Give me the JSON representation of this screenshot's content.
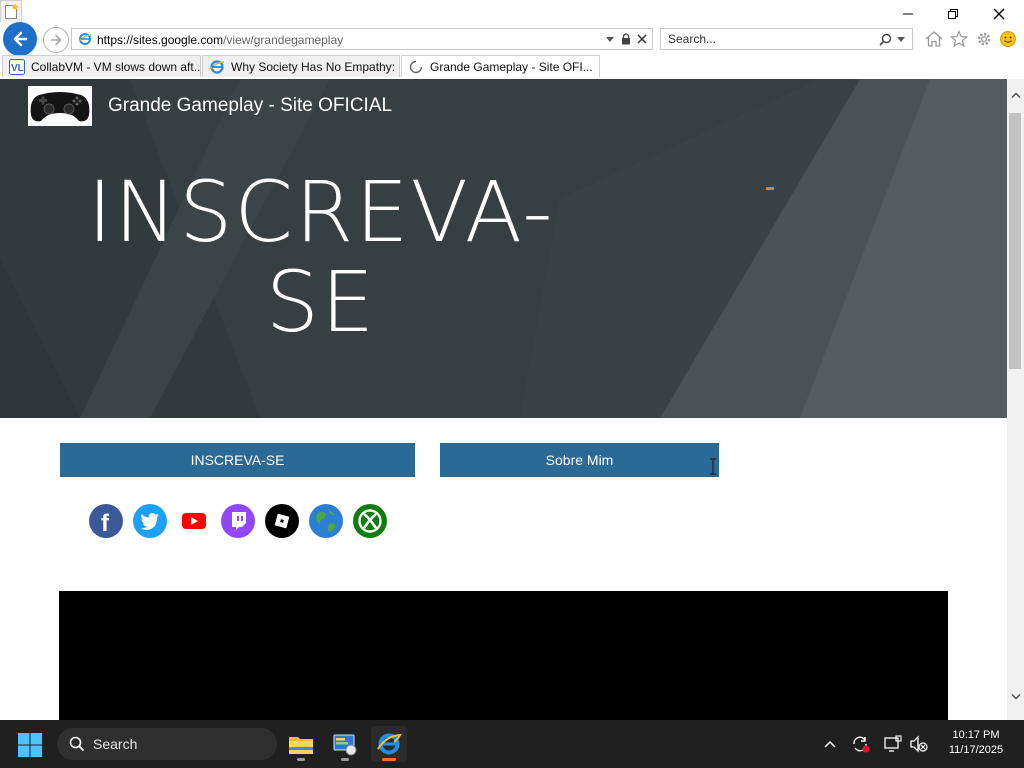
{
  "window": {
    "minimize_icon": "minimize-icon",
    "restore_icon": "restore-icon",
    "close_icon": "close-icon"
  },
  "toolbar": {
    "url_host": "https://sites.google.com",
    "url_path": "/view/grandegameplay",
    "search_placeholder": "Search...",
    "icons": [
      "back-icon",
      "forward-icon",
      "dropdown-icon",
      "lock-icon",
      "stop-icon",
      "search-icon",
      "home-icon",
      "favorites-icon",
      "settings-icon",
      "smiley-icon"
    ]
  },
  "tabs": [
    {
      "label": "CollabVM - VM slows down aft...",
      "icon": "collabvm-icon",
      "active": false
    },
    {
      "label": "Why Society Has No Empathy: ...",
      "icon": "ie-page-icon",
      "active": false
    },
    {
      "label": "Grande Gameplay - Site OFI...",
      "icon": "loading-icon",
      "active": true
    }
  ],
  "site": {
    "title": "Grande Gameplay - Site OFICIAL",
    "hero_heading_line1": "INSCREVA-",
    "hero_heading_line2": "SE",
    "buttons": {
      "subscribe": "INSCREVA-SE",
      "about": "Sobre Mim"
    },
    "social_links": [
      "facebook-icon",
      "twitter-icon",
      "youtube-icon",
      "twitch-icon",
      "roblox-icon",
      "globe-icon",
      "xbox-icon"
    ]
  },
  "taskbar": {
    "search_label": "Search",
    "apps": [
      "file-explorer-icon",
      "control-panel-icon",
      "internet-explorer-icon"
    ],
    "time": "10:17 PM",
    "date": "11/17/2025"
  },
  "colors": {
    "hero_bg": "#383f42",
    "button_bg": "#2b6a96",
    "ie_blue": "#1e6fc8",
    "taskbar_bg": "#202020",
    "accent_orange": "#e7821d"
  }
}
